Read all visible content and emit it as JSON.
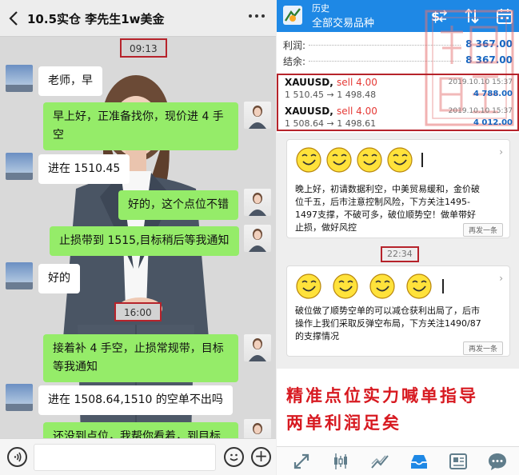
{
  "chat": {
    "back_icon": "chevron-left-icon",
    "title": "10.5实仓 李先生1w美金",
    "more_icon": "more-dots-icon",
    "timestamps": [
      "09:13",
      "16:00"
    ],
    "messages": [
      {
        "from": "client",
        "text": "老师，早"
      },
      {
        "from": "me",
        "text": "早上好，正准备找你，现价进 4 手空",
        "line1": "早上好，正准备找你，现价进 4 手",
        "line2": "空"
      },
      {
        "from": "client",
        "text": "进在 1510.45"
      },
      {
        "from": "me",
        "text": "好的，这个点位不错"
      },
      {
        "from": "me",
        "text": "止损带到 1515,目标稍后等我通知"
      },
      {
        "from": "client",
        "text": "好的"
      },
      {
        "from": "me",
        "text": "接着补 4 手空，止损常规带，目标等我通知",
        "line1": "接着补 4 手空，止损常规带，目标",
        "line2": "等我通知"
      },
      {
        "from": "client",
        "text": "进在 1508.64,1510 的空单不出吗"
      },
      {
        "from": "me",
        "text": "还没到点位，我帮你看着，到目标"
      }
    ],
    "input": {
      "voice_icon": "voice-icon",
      "emoji_icon": "emoji-icon",
      "plus_icon": "plus-icon",
      "plus_glyph": "+"
    }
  },
  "trade": {
    "header": {
      "history_label": "历史",
      "title": "全部交易品种",
      "icons": [
        "currency-switch-icon",
        "sort-icon",
        "calendar-icon"
      ]
    },
    "summary": {
      "profit_label": "利润:",
      "profit_value": "8 367.00",
      "balance_label": "结余:",
      "balance_value": "8 367.00"
    },
    "positions": [
      {
        "symbol": "XAUUSD,",
        "side": "sell 4.00",
        "price": "1 510.45 → 1 498.48",
        "time": "2019.10.10 15:37",
        "profit": "4 788.00"
      },
      {
        "symbol": "XAUUSD,",
        "side": "sell 4.00",
        "price": "1 508.64 → 1 498.61",
        "time": "2019.10.10 15:37",
        "profit": "4 012.00"
      }
    ],
    "cards": [
      {
        "line1": "晚上好，初请数据利空，中美贸易缓和，金价破",
        "line2": "位千五，后市注意控制风险，下方关注1495-",
        "line3": "1497支撑，不破可多，破位顺势空！做单带好",
        "line4": "止损，做好风控",
        "resend": "再发一条"
      },
      {
        "line1": "破位做了顺势空单的可以减仓获利出局了，后市",
        "line2": "操作上我们采取反弹空布局，下方关注1490/87",
        "line3": "的支撑情况",
        "resend": "再发一条"
      }
    ],
    "feed_timestamp": "22:34",
    "promo": {
      "line1": "精准点位实力喊单指导",
      "line2": "两单利润足矣"
    },
    "tabbar_icons": [
      "quotes-icon",
      "chart-icon",
      "trade-icon",
      "history-icon",
      "news-icon",
      "chat-icon"
    ],
    "accent_color": "#1e88e5",
    "highlight_color": "#b6232b"
  }
}
